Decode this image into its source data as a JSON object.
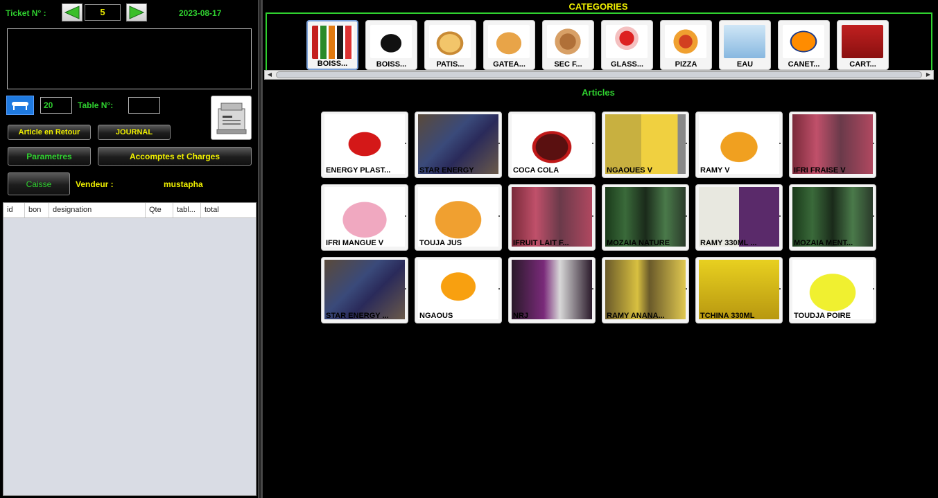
{
  "header": {
    "ticket_label": "Ticket N° :",
    "ticket_number": "5",
    "date": "2023-08-17"
  },
  "controls": {
    "couverts_value": "20",
    "table_label": "Table N°:",
    "table_value": "",
    "article_retour": "Article en Retour",
    "journal": "JOURNAL",
    "parametres": "Parametres",
    "accomptes": "Accomptes et Charges",
    "caisse": "Caisse",
    "vendeur_label": "Vendeur :",
    "vendeur_name": "mustapha"
  },
  "ticket_table": {
    "columns": [
      "id",
      "bon",
      "designation",
      "Qte",
      "tabl...",
      "total"
    ],
    "rows": []
  },
  "categories": {
    "title": "CATEGORIES",
    "items": [
      {
        "label": "BOISS...",
        "image": "soft-drinks-bottles"
      },
      {
        "label": "BOISS...",
        "image": "hot-drink-cup"
      },
      {
        "label": "PATIS...",
        "image": "pastry"
      },
      {
        "label": "GATEA...",
        "image": "cake"
      },
      {
        "label": "SEC F...",
        "image": "dried-fruits"
      },
      {
        "label": "GLASS...",
        "image": "ice-cream"
      },
      {
        "label": "PIZZA",
        "image": "pizza"
      },
      {
        "label": "EAU",
        "image": "water-bottle"
      },
      {
        "label": "CANET...",
        "image": "fanta-can"
      },
      {
        "label": "CART...",
        "image": "juice-carton"
      }
    ]
  },
  "articles": {
    "title": "Articles",
    "items": [
      {
        "label": "ENERGY PLAST...",
        "image": "energy-drink-bottle"
      },
      {
        "label": "STAR ENERGY",
        "image": "star-energy"
      },
      {
        "label": "COCA COLA",
        "image": "coca-cola-bottle"
      },
      {
        "label": "NGAOUES V",
        "image": "ngaous-bottles"
      },
      {
        "label": "RAMY V",
        "image": "ramy-bottle"
      },
      {
        "label": "IFRI FRAISE V",
        "image": "ifri-fraise"
      },
      {
        "label": "IFRI MANGUE V",
        "image": "ifri-mangue"
      },
      {
        "label": "TOUJA JUS",
        "image": "touja-juice"
      },
      {
        "label": "IFRUIT LAIT F...",
        "image": "ifruit-lait"
      },
      {
        "label": "MOZAIA NATURE",
        "image": "mozaia-nature"
      },
      {
        "label": "RAMY 330ML ...",
        "image": "ramy-330ml"
      },
      {
        "label": "MOZAIA MENT...",
        "image": "mozaia-menthe"
      },
      {
        "label": "STAR ENERGY ...",
        "image": "star-energy-2"
      },
      {
        "label": "NGAOUS",
        "image": "ngaous-fruit"
      },
      {
        "label": "NRJ",
        "image": "nrj"
      },
      {
        "label": "RAMY ANANA...",
        "image": "ramy-ananas"
      },
      {
        "label": "TCHINA 330ML",
        "image": "tchina-330ml"
      },
      {
        "label": "TOUDJA POIRE",
        "image": "toudja-poire"
      }
    ]
  },
  "colors": {
    "accent_green": "#2fd02f",
    "accent_yellow": "#f0f000",
    "background": "#000000",
    "table_bg": "#d9dce4"
  }
}
